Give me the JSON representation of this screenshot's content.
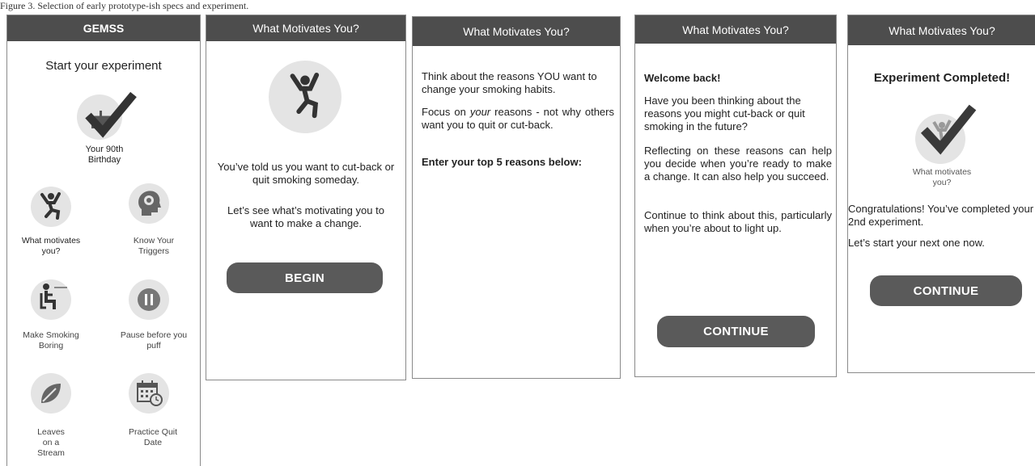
{
  "caption": "Figure 3. Selection of early prototype-ish specs and experiment.",
  "home": {
    "header": "GEMSS",
    "title": "Start your experiment",
    "featured_label": "Your 90th Birthday",
    "tiles": [
      {
        "label": "What motivates you?",
        "icon": "jumping-person-icon"
      },
      {
        "label": "Know Your Triggers",
        "icon": "head-gear-icon"
      },
      {
        "label": "Make Smoking Boring",
        "icon": "sitting-person-icon"
      },
      {
        "label": "Pause before you puff",
        "icon": "pause-icon"
      },
      {
        "label": "Leaves on a Stream",
        "icon": "leaf-icon"
      },
      {
        "label": "Practice Quit Date",
        "icon": "calendar-clock-icon"
      }
    ]
  },
  "intro": {
    "header": "What Motivates You?",
    "p1": "You’ve told us you want to cut-back or quit smoking someday.",
    "p2": "Let’s see what’s motivating you to want to make a change.",
    "button": "BEGIN"
  },
  "reasons": {
    "header": "What Motivates You?",
    "p1": "Think about the reasons YOU want to change your smoking habits.",
    "p2_before": "Focus on ",
    "p2_em": "your",
    "p2_after": " reasons - not why others want you to quit or cut-back.",
    "p3": "Enter your top 5 reasons below:"
  },
  "welcome": {
    "header": "What Motivates You?",
    "title": "Welcome back!",
    "p1": "Have you been thinking about the reasons you might cut-back or quit smoking in the future?",
    "p2": "Reflecting on these reasons can help you decide when you’re ready to make a change. It can also help you succeed.",
    "p3": "Continue to think about this, particularly when you’re about to light up.",
    "button": "CONTINUE"
  },
  "completed": {
    "header": "What Motivates You?",
    "title": "Experiment Completed!",
    "icon_label": "What motivates you?",
    "p1": "Congratulations! You’ve completed your 2nd experiment.",
    "p2": "Let’s start your next one now.",
    "button": "CONTINUE"
  },
  "colors": {
    "header": "#4d4d4d",
    "button": "#5a5a5a",
    "icon_bg": "#e4e4e4",
    "icon": "#333333"
  }
}
